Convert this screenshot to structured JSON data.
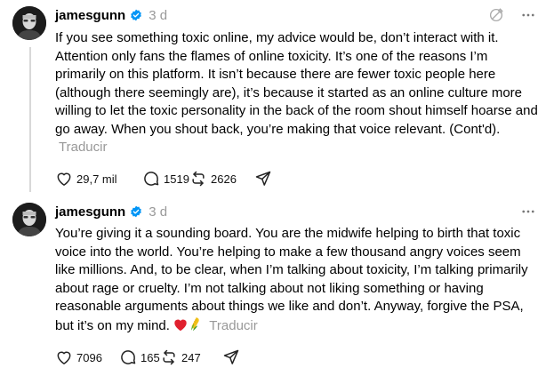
{
  "posts": [
    {
      "username": "jamesgunn",
      "time": "3 d",
      "text": "If you see something toxic online, my advice would be, don’t interact with it. Attention only fans the flames of online toxicity. It’s one of the reasons I’m primarily on this platform. It isn’t because there are fewer toxic people here (although there seemingly are), it’s because it started as an online culture more willing to let the toxic personality in the back of the room shout himself hoarse and go away. When you shout back, you’re making that voice relevant. (Cont'd).",
      "translate_label": "Traducir",
      "likes": "29,7 mil",
      "replies": "1519",
      "reposts": "2626"
    },
    {
      "username": "jamesgunn",
      "time": "3 d",
      "text": "You’re giving it a sounding board. You are the midwife helping to birth that toxic voice into the world. You’re helping to make a few thousand angry voices seem like millions. And, to be clear, when I’m talking about toxicity, I’m talking primarily about rage or cruelty. I’m not talking about not liking something or having reasonable arguments about things we like and don’t. Anyway, forgive the PSA, but it’s on my mind.",
      "emoji_icons": [
        "red-heart-icon",
        "corn-icon"
      ],
      "translate_label": "Traducir",
      "likes": "7096",
      "replies": "165",
      "reposts": "247"
    }
  ],
  "colors": {
    "verified": "#0095f6",
    "muted": "#999999",
    "thread_line": "#d8d8d8"
  }
}
